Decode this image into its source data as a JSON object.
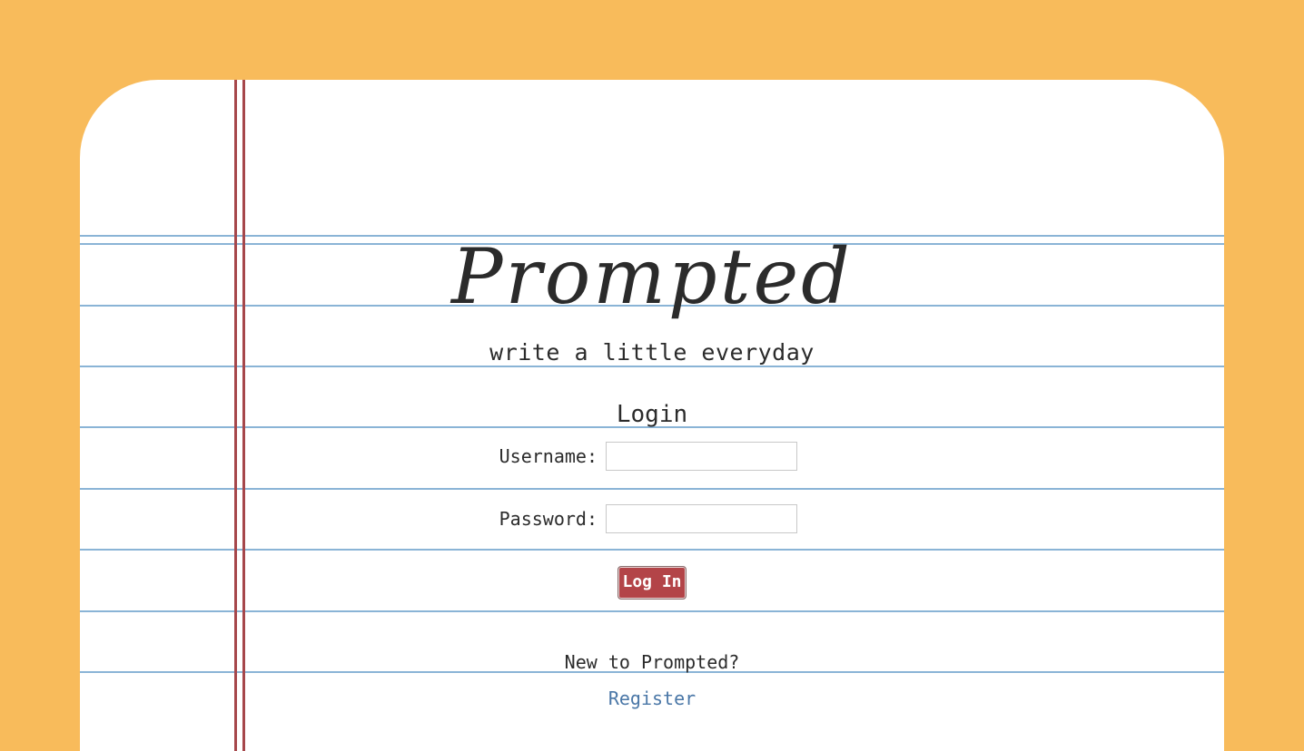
{
  "app": {
    "logo_text": "Prompted",
    "tagline": "write a little everyday"
  },
  "login": {
    "heading": "Login",
    "username_label": "Username:",
    "username_value": "",
    "password_label": "Password:",
    "password_value": "",
    "submit_label": "Log In"
  },
  "register": {
    "prompt": "New to Prompted?",
    "link_label": "Register"
  },
  "colors": {
    "background": "#f8bb5b",
    "paper": "#ffffff",
    "rule_line": "#8ab4d6",
    "margin_line": "#a6474b",
    "button": "#b34448",
    "link": "#4a77a7"
  }
}
